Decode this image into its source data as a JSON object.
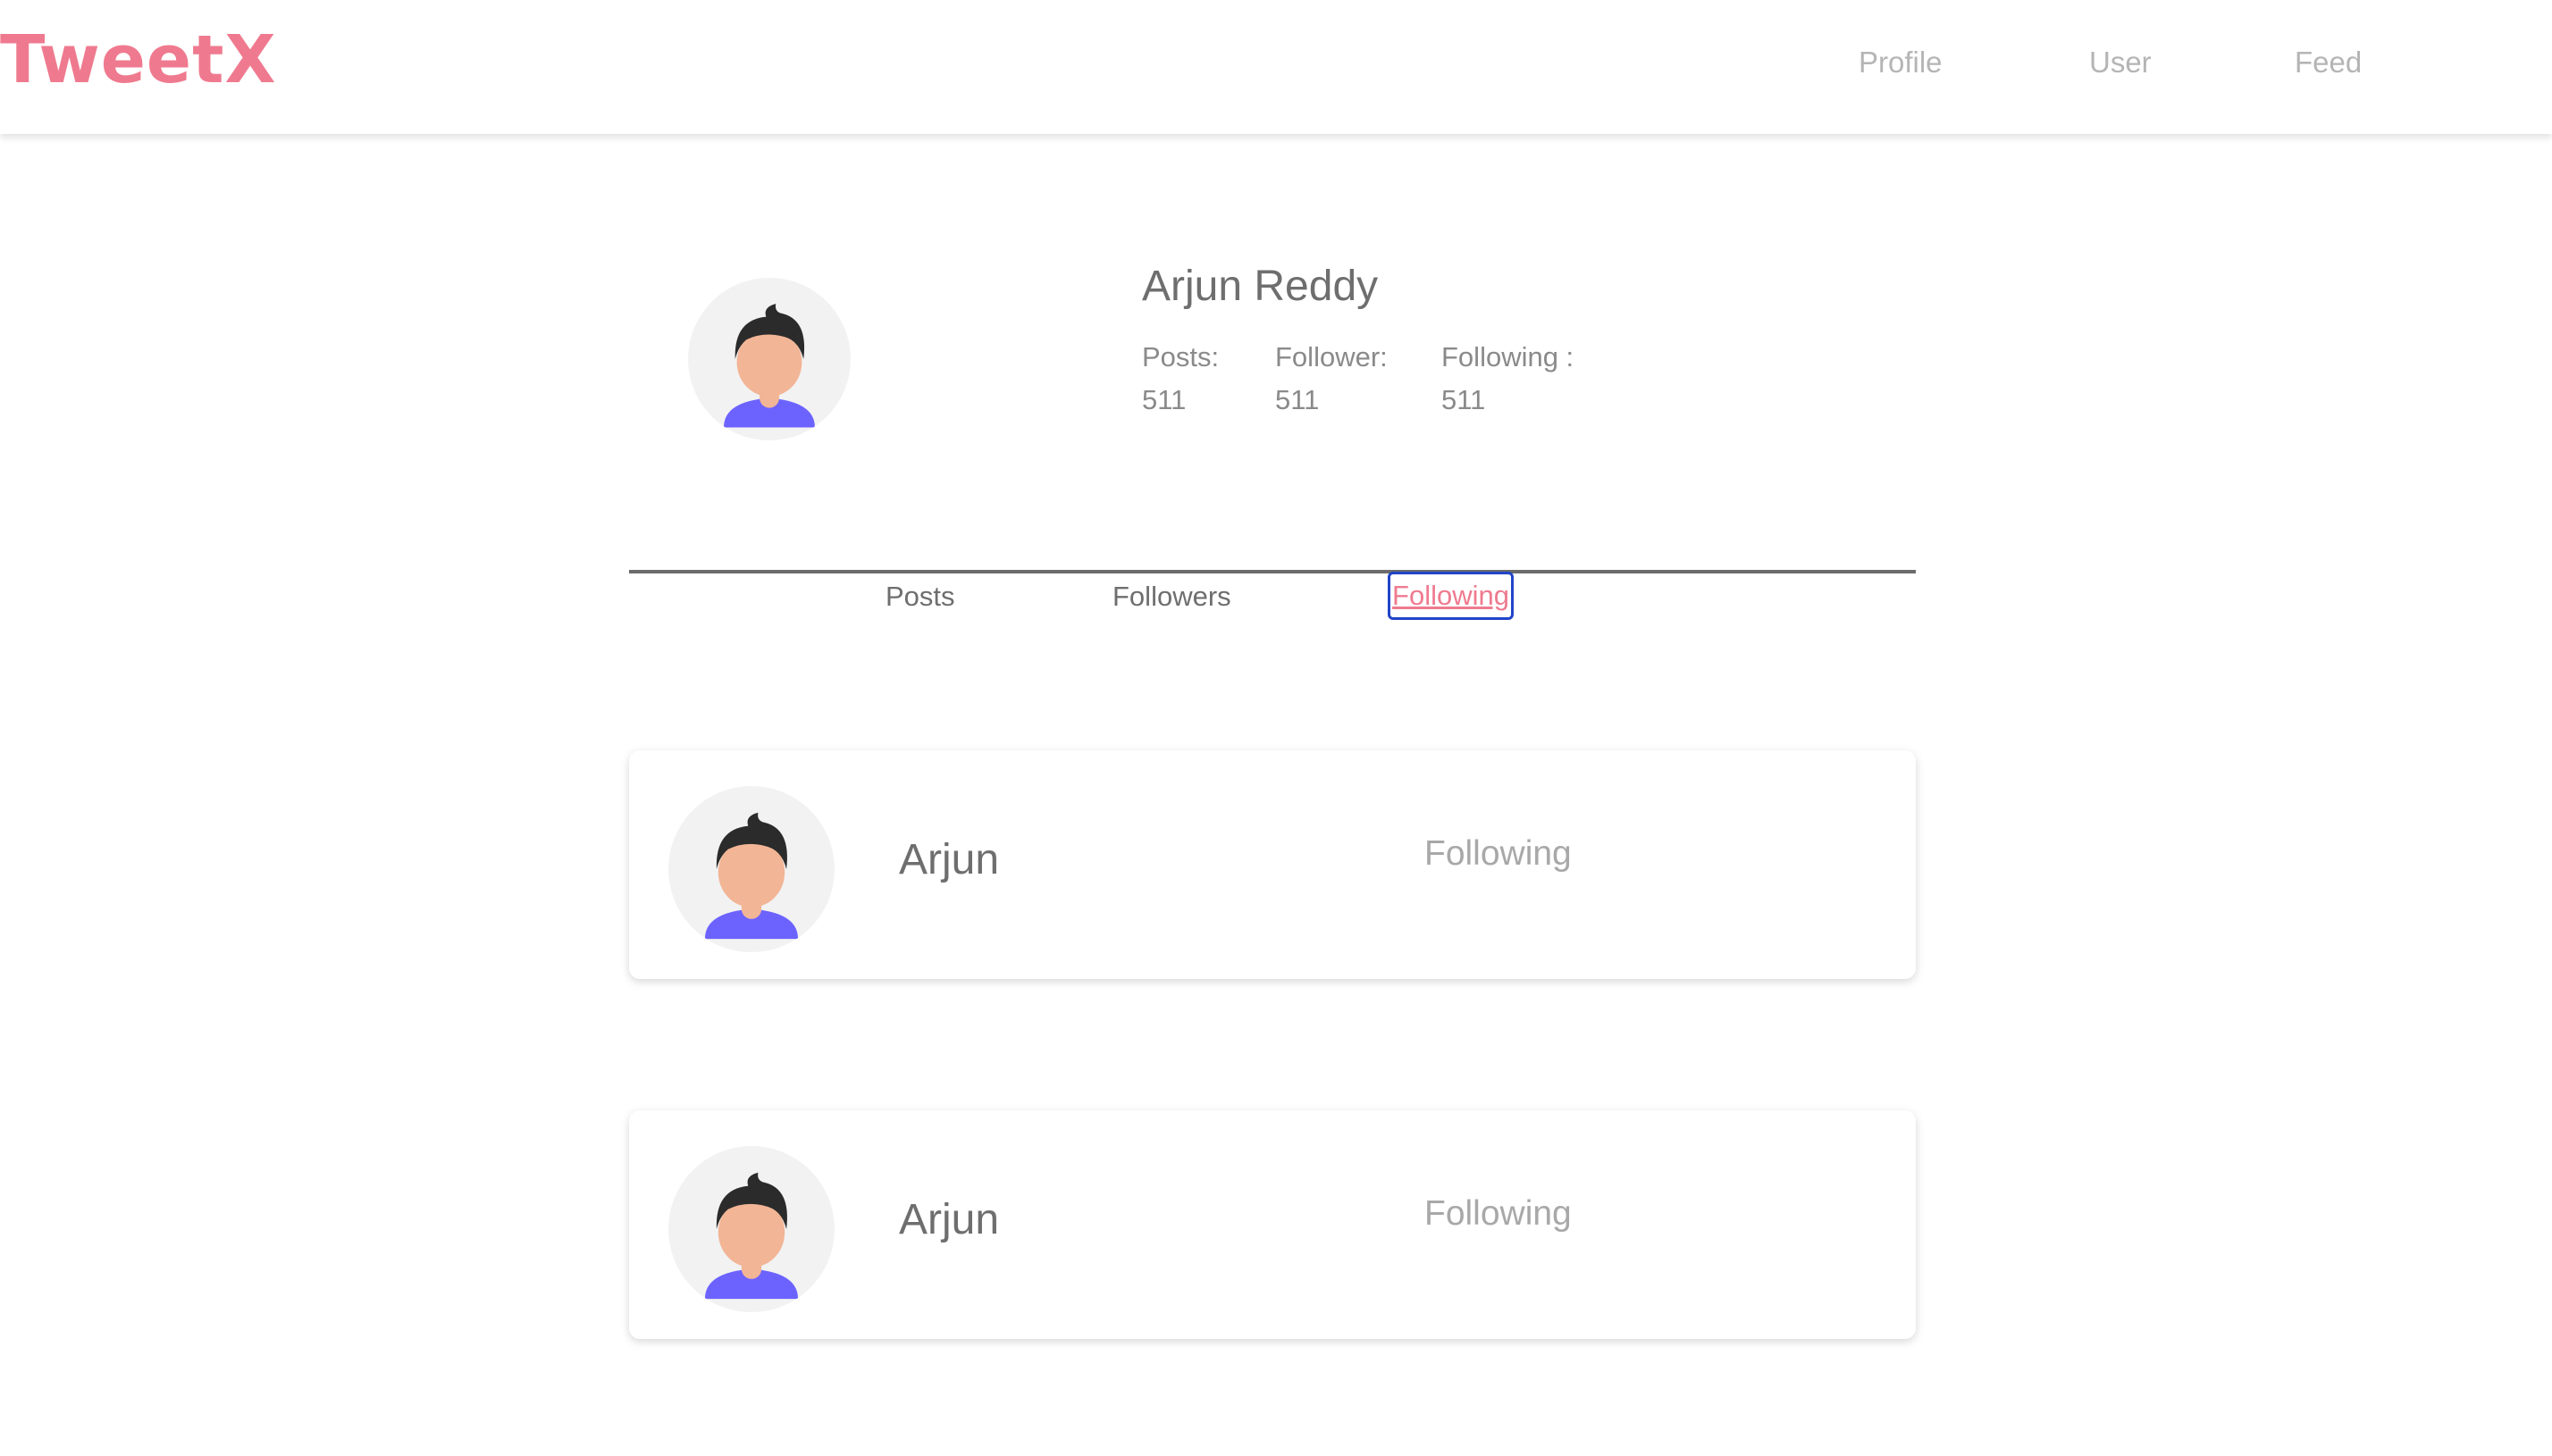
{
  "header": {
    "logo": "TweetX",
    "nav": {
      "profile": "Profile",
      "user": "User",
      "feed": "Feed"
    }
  },
  "profile": {
    "name": "Arjun Reddy",
    "stats": {
      "posts_label": "Posts:",
      "posts_value": "511",
      "followers_label": "Follower:",
      "followers_value": "511",
      "following_label": "Following :",
      "following_value": "511"
    }
  },
  "tabs": {
    "posts": "Posts",
    "followers": "Followers",
    "following": "Following",
    "active": "following"
  },
  "following_list": [
    {
      "name": "Arjun",
      "action": "Following"
    },
    {
      "name": "Arjun",
      "action": "Following"
    }
  ],
  "colors": {
    "brand": "#ef7a8f",
    "focus_ring": "#2144c8",
    "avatar_hair": "#2b2b2b",
    "avatar_skin": "#f2b596",
    "avatar_shirt": "#6c63ff"
  },
  "icons": {
    "avatar": "user-avatar-icon"
  }
}
